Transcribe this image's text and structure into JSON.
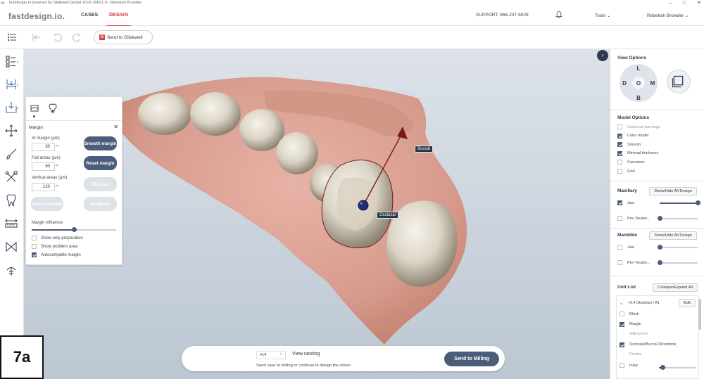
{
  "window": {
    "title": "fastdesign.io powered by Glidewell Dental 10.00.30651.0 - Rebekah Browder"
  },
  "topnav": {
    "brand": "fastdesign.io.",
    "tabs": [
      {
        "label": "CASES",
        "active": false
      },
      {
        "label": "DESIGN",
        "active": true
      }
    ],
    "support": "SUPPORT: 866-237-6929",
    "tools": "Tools",
    "user": "Rebekah Browder"
  },
  "toolbar": {
    "send_glidewell": "Send to Glidewell"
  },
  "margin_panel": {
    "title": "Margin",
    "at_margin_label": "At margin (µm)",
    "at_margin_value": "30",
    "flat_areas_label": "Flat areas (µm)",
    "flat_areas_value": "90",
    "vertical_areas_label": "Vertical areas (µm)",
    "vertical_areas_value": "120",
    "smooth_margin": "Smooth margin",
    "reset_margin": "Reset margin",
    "flip_jaws": "Flip jaws",
    "reset_settings": "Reset settings",
    "margin_ai": "MarginAI",
    "margin_influence_label": "Margin influence",
    "margin_influence": 0.5,
    "checks": [
      {
        "label": "Show only preparation",
        "checked": false
      },
      {
        "label": "Show problem area",
        "checked": false
      },
      {
        "label": "Autocomplete margin",
        "checked": true
      }
    ]
  },
  "viewport": {
    "buccal_label": "Buccal",
    "occlusal_label": "Occlusal"
  },
  "badge": "7a",
  "actionbar": {
    "tooth_select": "#14",
    "status": "View nesting",
    "hint": "Send case to milling or continue to design the crown",
    "send_milling": "Send to Milling"
  },
  "rightpanel": {
    "view_options_title": "View Options",
    "dial": {
      "top": "L",
      "left": "D",
      "center": "O",
      "right": "M",
      "bottom": "B"
    },
    "model_options_title": "Model Options",
    "model_options": [
      {
        "label": "Undercut warnings",
        "checked": false,
        "dim": true
      },
      {
        "label": "Color model",
        "checked": true,
        "dim": false
      },
      {
        "label": "Smooth",
        "checked": true,
        "dim": false
      },
      {
        "label": "Minimal thickness",
        "checked": true,
        "dim": false
      },
      {
        "label": "Curvature",
        "checked": false,
        "dim": false
      },
      {
        "label": "Grid",
        "checked": false,
        "dim": false
      }
    ],
    "maxillary_title": "Maxillary",
    "maxillary_btn": "Show/Hide All Design",
    "maxillary_jaw": "Jaw",
    "maxillary_jaw_checked": true,
    "maxillary_jaw_level": 1.0,
    "maxillary_pretreat": "Pre-Treatm...",
    "maxillary_pretreat_level": 0.0,
    "mandible_title": "Mandible",
    "mandible_btn": "Show/Hide All Design",
    "mandible_jaw": "Jaw",
    "mandible_jaw_level": 0.0,
    "mandible_pretreat": "Pre-Treatm...",
    "mandible_pretreat_level": 0.0,
    "unitlist_title": "Unit List",
    "unitlist_btn": "Collapse/Expand All",
    "unit_name": "#14 Obsidian | A1",
    "unit_edit": "Edit",
    "unit_items": [
      {
        "label": "Block",
        "checked": false,
        "dim": false
      },
      {
        "label": "Margin",
        "checked": true,
        "dim": false
      },
      {
        "label": "Milling line",
        "checked": null,
        "dim": true
      },
      {
        "label": "Occlusal/Buccal Directions",
        "checked": true,
        "dim": false
      },
      {
        "label": "Preline",
        "checked": null,
        "dim": true
      },
      {
        "label": "Inlay",
        "checked": false,
        "dim": false
      }
    ],
    "inlay_level": 0.1
  }
}
